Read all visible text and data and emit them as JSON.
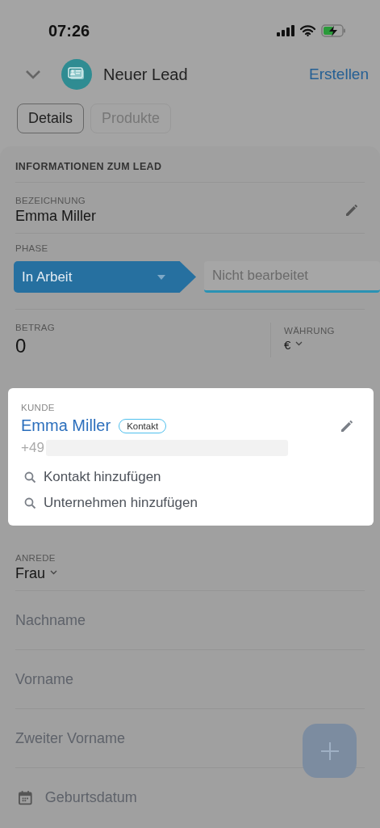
{
  "status_bar": {
    "time": "07:26"
  },
  "header": {
    "title": "Neuer Lead",
    "action": "Erstellen"
  },
  "tabs": [
    {
      "label": "Details",
      "selected": true
    },
    {
      "label": "Produkte",
      "selected": false
    }
  ],
  "section": {
    "title": "INFORMATIONEN ZUM LEAD",
    "fields": [
      {
        "kind": "text",
        "label": "BEZEICHNUNG",
        "value": "Emma Miller"
      },
      {
        "kind": "phase",
        "label": "PHASE",
        "stages": [
          {
            "label": "In Arbeit",
            "selected": true,
            "color": "#2670a0"
          },
          {
            "label": "Nicht bearbeitet",
            "selected": false,
            "color": "#2a92b4"
          }
        ]
      },
      {
        "kind": "amount",
        "label": "BETRAG",
        "value": "0",
        "currency_label": "WÄHRUNG",
        "currency_value": "€"
      },
      {
        "kind": "customer",
        "label": "KUNDE",
        "name": "Emma Miller",
        "tag": "Kontakt",
        "phone": "+49",
        "actions": [
          "Kontakt hinzufügen",
          "Unternehmen hinzufügen"
        ]
      },
      {
        "kind": "select",
        "label": "ANREDE",
        "value": "Frau"
      },
      {
        "kind": "placeholder",
        "placeholder": "Nachname"
      },
      {
        "kind": "placeholder",
        "placeholder": "Vorname"
      },
      {
        "kind": "placeholder",
        "placeholder": "Zweiter Vorname"
      },
      {
        "kind": "date",
        "placeholder": "Geburtsdatum"
      }
    ]
  }
}
